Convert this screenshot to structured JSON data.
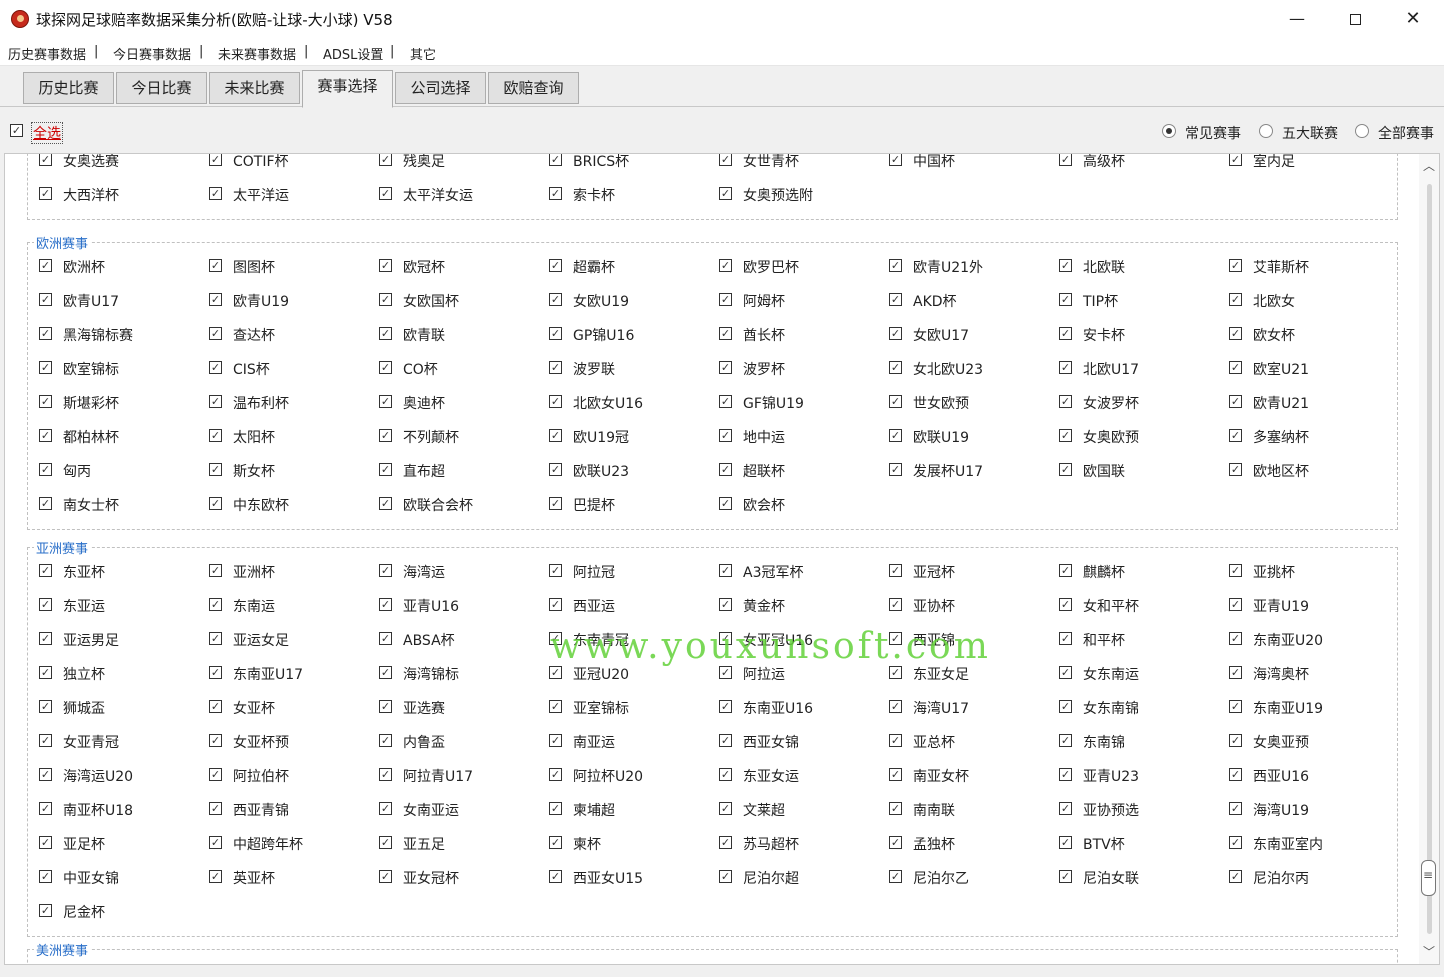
{
  "window": {
    "title": "球探网足球赔率数据采集分析(欧赔-让球-大小球) V58",
    "minimize": "—",
    "close": "✕"
  },
  "menu": [
    "历史赛事数据",
    "|",
    "今日赛事数据",
    "|",
    "未来赛事数据",
    "|",
    "ADSL设置",
    "|",
    "其它"
  ],
  "tabs": [
    "历史比赛",
    "今日比赛",
    "未来比赛",
    "赛事选择",
    "公司选择",
    "欧赔查询"
  ],
  "active_tab": "赛事选择",
  "select_all": {
    "label": "全选",
    "checked": true
  },
  "radios": [
    {
      "label": "常见赛事",
      "selected": true
    },
    {
      "label": "五大联赛",
      "selected": false
    },
    {
      "label": "全部赛事",
      "selected": false
    }
  ],
  "groups": [
    {
      "title": "",
      "items": [
        "女奥选赛",
        "COTIF杯",
        "残奥足",
        "BRICS杯",
        "女世青杯",
        "中国杯",
        "高级杯",
        "室内足",
        "大西洋杯",
        "太平洋运",
        "太平洋女运",
        "索卡杯",
        "女奥预选附"
      ]
    },
    {
      "title": "欧洲赛事",
      "items": [
        "欧洲杯",
        "图图杯",
        "欧冠杯",
        "超霸杯",
        "欧罗巴杯",
        "欧青U21外",
        "北欧联",
        "艾菲斯杯",
        "欧青U17",
        "欧青U19",
        "女欧国杯",
        "女欧U19",
        "阿姆杯",
        "AKD杯",
        "TIP杯",
        "北欧女",
        "黑海锦标赛",
        "查达杯",
        "欧青联",
        "GP锦U16",
        "酋长杯",
        "女欧U17",
        "安卡杯",
        "欧女杯",
        "欧室锦标",
        "CIS杯",
        "CO杯",
        "波罗联",
        "波罗杯",
        "女北欧U23",
        "北欧U17",
        "欧室U21",
        "斯堪彩杯",
        "温布利杯",
        "奥迪杯",
        "北欧女U16",
        "GF锦U19",
        "世女欧预",
        "女波罗杯",
        "欧青U21",
        "都柏林杯",
        "太阳杯",
        "不列颠杯",
        "欧U19冠",
        "地中运",
        "欧联U19",
        "女奥欧预",
        "多塞纳杯",
        "匈丙",
        "斯女杯",
        "直布超",
        "欧联U23",
        "超联杯",
        "发展杯U17",
        "欧国联",
        "欧地区杯",
        "南女士杯",
        "中东欧杯",
        "欧联合会杯",
        "巴提杯",
        "欧会杯"
      ]
    },
    {
      "title": "亚洲赛事",
      "items": [
        "东亚杯",
        "亚洲杯",
        "海湾运",
        "阿拉冠",
        "A3冠军杯",
        "亚冠杯",
        "麒麟杯",
        "亚挑杯",
        "东亚运",
        "东南运",
        "亚青U16",
        "西亚运",
        "黄金杯",
        "亚协杯",
        "女和平杯",
        "亚青U19",
        "亚运男足",
        "亚运女足",
        "ABSA杯",
        "东南青冠",
        "女亚冠U16",
        "西亚锦",
        "和平杯",
        "东南亚U20",
        "独立杯",
        "东南亚U17",
        "海湾锦标",
        "亚冠U20",
        "阿拉运",
        "东亚女足",
        "女东南运",
        "海湾奥杯",
        "狮城盃",
        "女亚杯",
        "亚选赛",
        "亚室锦标",
        "东南亚U16",
        "海湾U17",
        "女东南锦",
        "东南亚U19",
        "女亚青冠",
        "女亚杯预",
        "内鲁盃",
        "南亚运",
        "西亚女锦",
        "亚总杯",
        "东南锦",
        "女奥亚预",
        "海湾运U20",
        "阿拉伯杯",
        "阿拉青U17",
        "阿拉杯U20",
        "东亚女运",
        "南亚女杯",
        "亚青U23",
        "西亚U16",
        "南亚杯U18",
        "西亚青锦",
        "女南亚运",
        "柬埔超",
        "文莱超",
        "南南联",
        "亚协预选",
        "海湾U19",
        "亚足杯",
        "中超跨年杯",
        "亚五足",
        "柬杯",
        "苏马超杯",
        "孟独杯",
        "BTV杯",
        "东南亚室内",
        "中亚女锦",
        "英亚杯",
        "亚女冠杯",
        "西亚女U15",
        "尼泊尔超",
        "尼泊尔乙",
        "尼泊女联",
        "尼泊尔丙",
        "尼金杯"
      ]
    },
    {
      "title": "美洲赛事",
      "items": []
    }
  ],
  "watermark": "www.youxunsoft.com",
  "scroll": {
    "up": "︿",
    "down": "﹀"
  }
}
